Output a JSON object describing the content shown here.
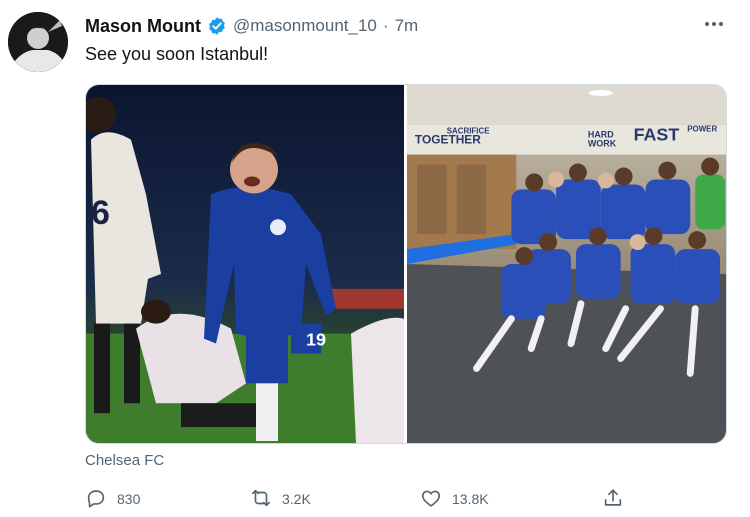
{
  "tweet": {
    "author": {
      "display_name": "Mason Mount",
      "handle": "@masonmount_10",
      "separator": "·",
      "time": "7m",
      "verified": true
    },
    "text": "See you soon Istanbul!",
    "media": [
      {
        "icon": "photo-celebration"
      },
      {
        "icon": "photo-dressing-room",
        "wall_text": [
          "SACRIFICE",
          "TOGETHER",
          "HARD",
          "WORK",
          "FAST",
          "POWER"
        ]
      }
    ],
    "source_label": "Chelsea FC",
    "actions": {
      "reply_count": "830",
      "retweet_count": "3.2K",
      "like_count": "13.8K"
    },
    "colors": {
      "verified_blue": "#1d9bf0",
      "secondary_text": "#536471",
      "chelsea_blue": "#1a3fa0"
    }
  }
}
